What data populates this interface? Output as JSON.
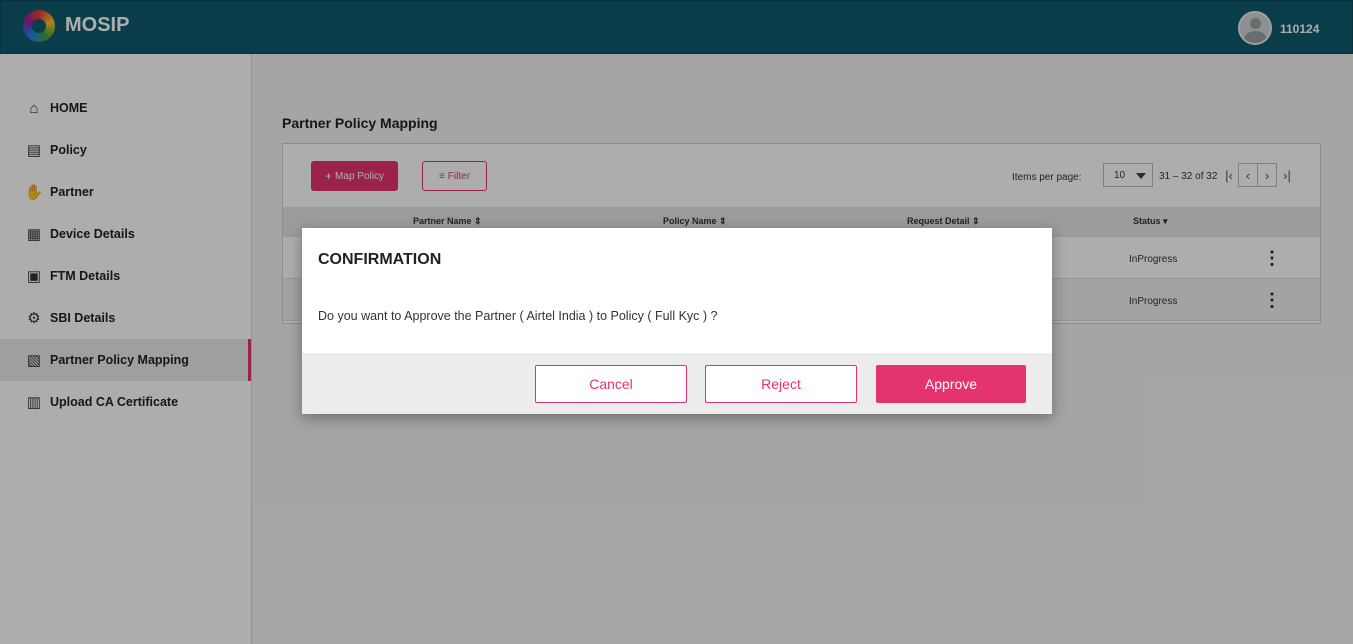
{
  "header": {
    "brand": "MOSIP",
    "user_id": "110124"
  },
  "sidebar": {
    "items": [
      {
        "label": "HOME",
        "icon": "home-icon",
        "active": false
      },
      {
        "label": "Policy",
        "icon": "policy-document-icon",
        "active": false
      },
      {
        "label": "Partner",
        "icon": "handshake-icon",
        "active": false
      },
      {
        "label": "Device Details",
        "icon": "device-icon",
        "active": false
      },
      {
        "label": "FTM Details",
        "icon": "chip-icon",
        "active": false
      },
      {
        "label": "SBI Details",
        "icon": "gear-code-icon",
        "active": false
      },
      {
        "label": "Partner Policy Mapping",
        "icon": "mapping-icon",
        "active": true
      },
      {
        "label": "Upload CA Certificate",
        "icon": "certificate-icon",
        "active": false
      }
    ]
  },
  "main": {
    "title": "Partner Policy Mapping",
    "map_policy_label": "Map Policy",
    "filter_label": "Filter",
    "items_per_page_label": "Items per page:",
    "items_per_page_value": "10",
    "range_label": "31 – 32 of 32",
    "columns": [
      "Partner Name",
      "Policy Name",
      "Request Detail",
      "Status"
    ],
    "rows": [
      {
        "status": "InProgress"
      },
      {
        "status": "InProgress"
      }
    ]
  },
  "dialog": {
    "title": "CONFIRMATION",
    "message": "Do you want to Approve the Partner ( Airtel India ) to Policy ( Full Kyc ) ?",
    "cancel_label": "Cancel",
    "reject_label": "Reject",
    "approve_label": "Approve"
  },
  "colors": {
    "header": "#0e5a6e",
    "accent": "#e5336f"
  }
}
